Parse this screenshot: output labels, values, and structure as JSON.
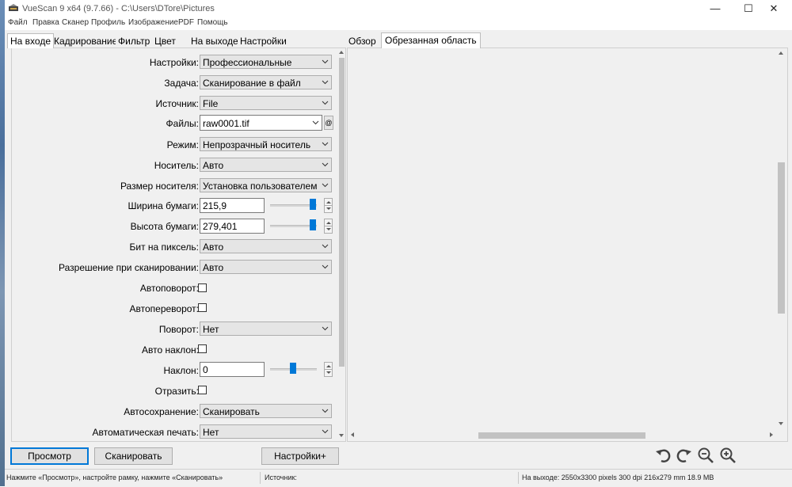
{
  "window": {
    "title": "VueScan 9 x64 (9.7.66) - C:\\Users\\DTore\\Pictures",
    "minimize": "—",
    "maximize": "☐",
    "close": "✕"
  },
  "menu": [
    "Файл",
    "Правка",
    "Сканер",
    "Профиль",
    "Изображение",
    "PDF",
    "Помощь"
  ],
  "left_tabs": [
    "На входе",
    "Кадрирование",
    "Фильтр",
    "Цвет",
    "На выходе",
    "Настройки"
  ],
  "fields": {
    "settings": {
      "label": "Настройки:",
      "value": "Профессиональные"
    },
    "task": {
      "label": "Задача:",
      "value": "Сканирование в файл"
    },
    "source": {
      "label": "Источник:",
      "value": "File"
    },
    "files": {
      "label": "Файлы:",
      "value": "raw0001.tif",
      "button": "@"
    },
    "mode": {
      "label": "Режим:",
      "value": "Непрозрачный носитель"
    },
    "media": {
      "label": "Носитель:",
      "value": "Авто"
    },
    "media_size": {
      "label": "Размер носителя:",
      "value": "Установка пользователем"
    },
    "paper_width": {
      "label": "Ширина бумаги:",
      "value": "215,9"
    },
    "paper_height": {
      "label": "Высота бумаги:",
      "value": "279,401"
    },
    "bits": {
      "label": "Бит на пиксель:",
      "value": "Авто"
    },
    "resolution": {
      "label": "Разрешение при сканировании:",
      "value": "Авто"
    },
    "auto_rotate": {
      "label": "Автоповорот:"
    },
    "auto_flip": {
      "label": "Автопереворот:"
    },
    "rotation": {
      "label": "Поворот:",
      "value": "Нет"
    },
    "auto_skew": {
      "label": "Авто наклон:"
    },
    "skew": {
      "label": "Наклон:",
      "value": "0"
    },
    "mirror": {
      "label": "Отразить:"
    },
    "auto_save": {
      "label": "Автосохранение:",
      "value": "Сканировать"
    },
    "auto_print": {
      "label": "Автоматическая печать:",
      "value": "Нет"
    }
  },
  "right_tabs": [
    "Обзор",
    "Обрезанная область"
  ],
  "buttons": {
    "preview": "Просмотр",
    "scan": "Сканировать",
    "settings_plus": "Настройки+"
  },
  "icons": {
    "rotate_left": "rotate-left-icon",
    "rotate_right": "rotate-right-icon",
    "zoom_out": "zoom-out-icon",
    "zoom_in": "zoom-in-icon"
  },
  "status": {
    "hint": "Нажмите «Просмотр», настройте рамку, нажмите «Сканировать»",
    "source": "Источник:",
    "output": "На выходе: 2550x3300 pixels 300 dpi 216x279 mm 18.9 MB"
  }
}
